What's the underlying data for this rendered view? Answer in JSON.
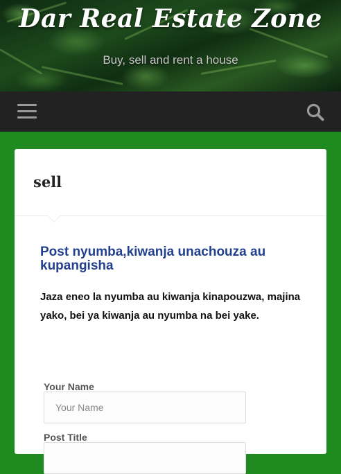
{
  "site": {
    "title": "Dar Real Estate Zone",
    "tagline": "Buy, sell and rent a house"
  },
  "nav": {
    "menu_icon": "hamburger-icon",
    "search_icon": "search-icon"
  },
  "page": {
    "title": "sell",
    "heading": "Post nyumba,kiwanja unachouza au kupangisha",
    "description": "Jaza eneo la nyumba au kiwanja kinapouzwa, majina yako, bei ya kiwanja au nyumba na bei yake."
  },
  "form": {
    "fields": [
      {
        "label": "Your Name",
        "placeholder": "Your Name",
        "value": ""
      },
      {
        "label": "Post Title",
        "placeholder": "",
        "value": ""
      }
    ]
  },
  "colors": {
    "background": "#1f8a1f",
    "navbar": "#222222",
    "heading": "#23408e",
    "title_text": "#ffffff"
  }
}
